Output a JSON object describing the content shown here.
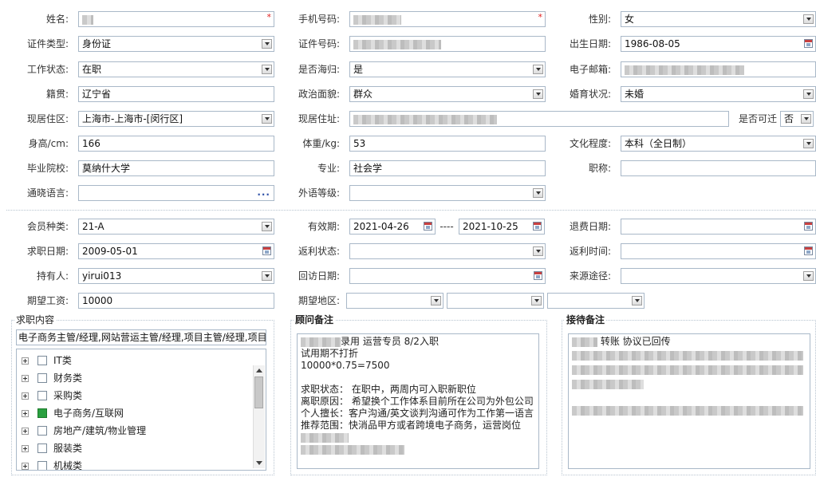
{
  "personal": {
    "name_label": "姓名:",
    "phone_label": "手机号码:",
    "gender_label": "性别:",
    "gender_value": "女",
    "id_type_label": "证件类型:",
    "id_type_value": "身份证",
    "id_no_label": "证件号码:",
    "birth_label": "出生日期:",
    "birth_value": "1986-08-05",
    "work_status_label": "工作状态:",
    "work_status_value": "在职",
    "returnee_label": "是否海归:",
    "returnee_value": "是",
    "email_label": "电子邮箱:",
    "native_label": "籍贯:",
    "native_value": "辽宁省",
    "political_label": "政治面貌:",
    "political_value": "群众",
    "marital_label": "婚育状况:",
    "marital_value": "未婚",
    "residence_label": "现居住区:",
    "residence_value": "上海市-上海市-[闵行区]",
    "address_label": "现居住址:",
    "relocate_label": "是否可迁",
    "relocate_value": "否",
    "height_label": "身高/cm:",
    "height_value": "166",
    "weight_label": "体重/kg:",
    "weight_value": "53",
    "education_label": "文化程度:",
    "education_value": "本科（全日制）",
    "school_label": "毕业院校:",
    "school_value": "莫纳什大学",
    "major_label": "专业:",
    "major_value": "社会学",
    "title_label": "职称:",
    "title_value": "",
    "language_label": "通晓语言:",
    "language_value": "",
    "foreign_level_label": "外语等级:",
    "foreign_level_value": "",
    "required_mark": "*",
    "more_icon": "..."
  },
  "membership": {
    "member_type_label": "会员种类:",
    "member_type_value": "21-A",
    "valid_label": "有效期:",
    "valid_from": "2021-04-26",
    "valid_sep": "----",
    "valid_to": "2021-10-25",
    "refund_date_label": "退费日期:",
    "refund_date_value": "",
    "apply_date_label": "求职日期:",
    "apply_date_value": "2009-05-01",
    "rebate_status_label": "返利状态:",
    "rebate_status_value": "",
    "rebate_time_label": "返利时间:",
    "rebate_time_value": "",
    "holder_label": "持有人:",
    "holder_value": "yirui013",
    "visit_date_label": "回访日期:",
    "visit_date_value": "",
    "source_label": "来源途径:",
    "source_value": "",
    "salary_label": "期望工资:",
    "salary_value": "10000",
    "region_label": "期望地区:"
  },
  "job_panel": {
    "title": "求职内容",
    "selected": "电子商务主管/经理,网站营运主管/经理,项目主管/经理,项目",
    "items": [
      {
        "label": "IT类",
        "checked": false
      },
      {
        "label": "财务类",
        "checked": false
      },
      {
        "label": "采购类",
        "checked": false
      },
      {
        "label": "电子商务/互联网",
        "checked": true
      },
      {
        "label": "房地产/建筑/物业管理",
        "checked": false
      },
      {
        "label": "服装类",
        "checked": false
      },
      {
        "label": "机械类",
        "checked": false
      }
    ]
  },
  "advisor_panel": {
    "title": "顾问备注",
    "lines": [
      "录用   运营专员   8/2入职",
      "试用期不打折",
      "10000*0.75=7500",
      "",
      "求职状态：  在职中，两周内可入职新职位",
      "离职原因：  希望换个工作体系目前所在公司为外包公司",
      "个人擅长：客户沟通/英文谈判沟通可作为工作第一语言",
      "推荐范围：快消品甲方或者跨境电子商务，运营岗位"
    ]
  },
  "reception_panel": {
    "title": "接待备注",
    "first_line": "转账  协议已回传"
  },
  "colors": {
    "border": "#a9b8c8",
    "required": "#e02020",
    "checked": "#2aa040"
  }
}
